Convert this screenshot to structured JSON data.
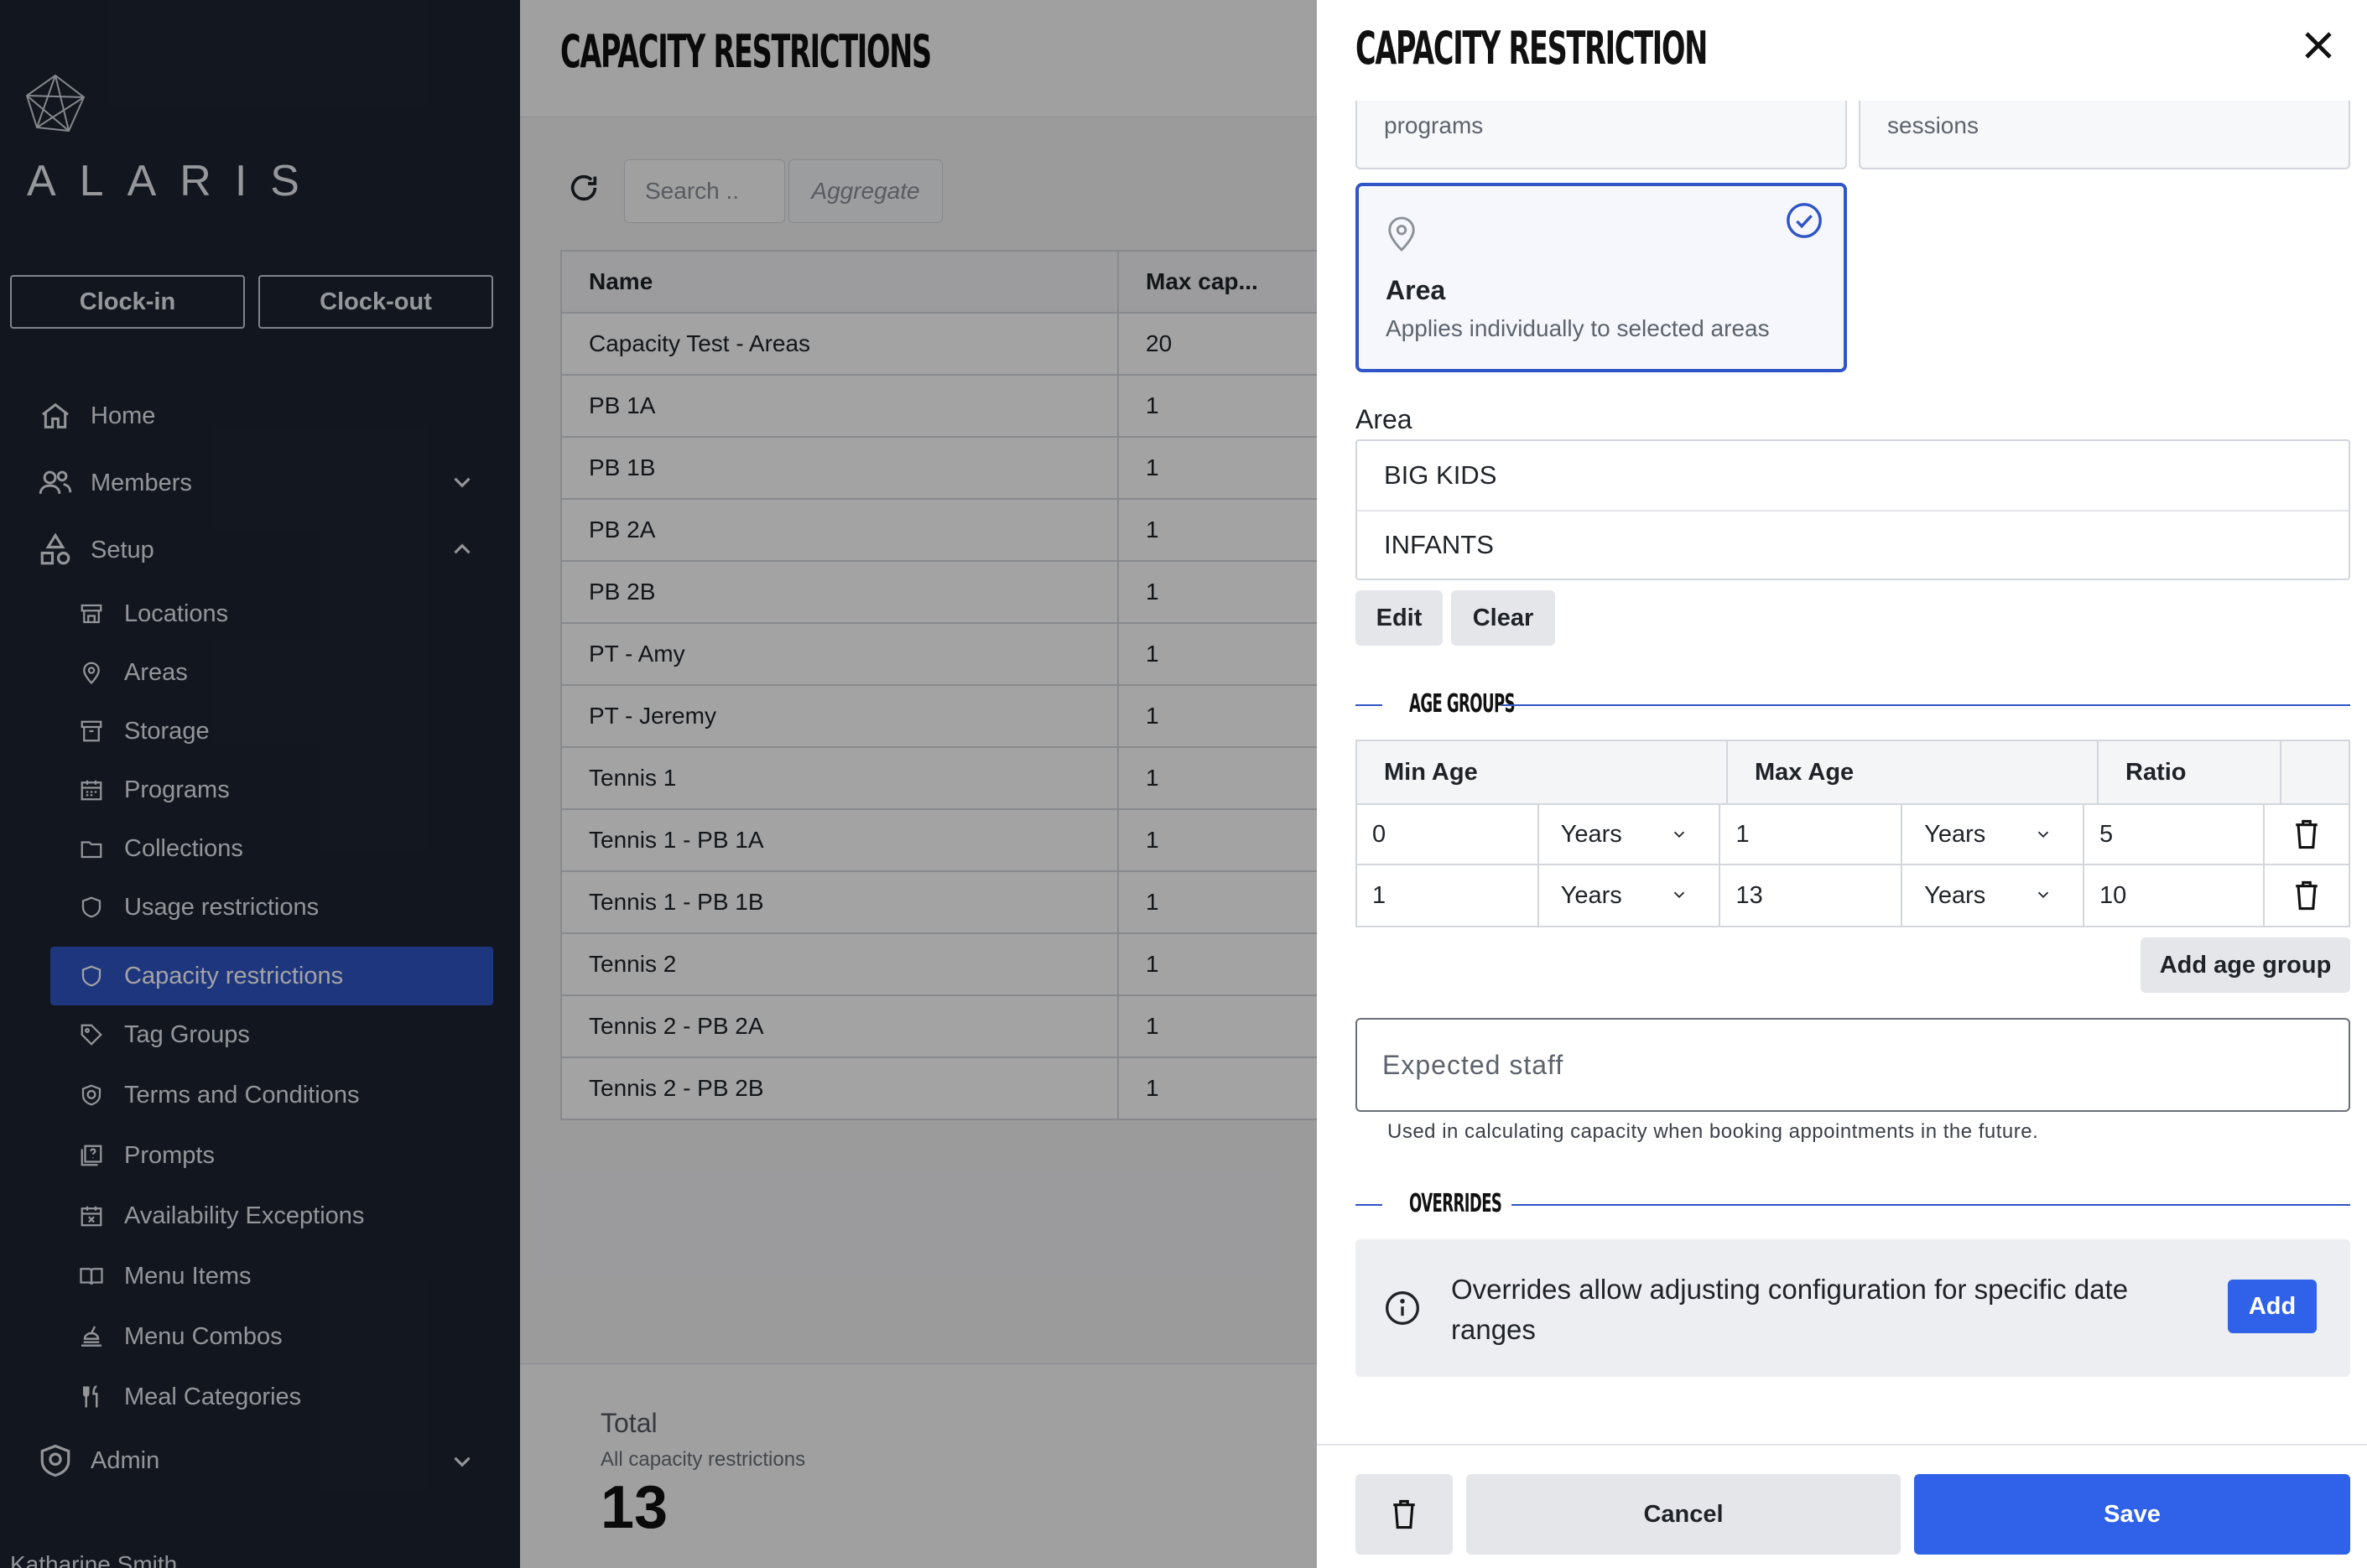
{
  "brand": {
    "logo_text": "ALARIS"
  },
  "sidebar": {
    "clock_in": "Clock-in",
    "clock_out": "Clock-out",
    "home": "Home",
    "members": "Members",
    "setup": "Setup",
    "setup_items": [
      {
        "label": "Locations",
        "icon": "store-icon"
      },
      {
        "label": "Areas",
        "icon": "map-pin-icon"
      },
      {
        "label": "Storage",
        "icon": "archive-icon"
      },
      {
        "label": "Programs",
        "icon": "calendar-icon"
      },
      {
        "label": "Collections",
        "icon": "folder-icon"
      },
      {
        "label": "Usage restrictions",
        "icon": "shield-icon"
      },
      {
        "label": "Capacity restrictions",
        "icon": "shield-icon",
        "active": true
      },
      {
        "label": "Tag Groups",
        "icon": "tag-icon"
      },
      {
        "label": "Terms and Conditions",
        "icon": "shield-check-icon"
      },
      {
        "label": "Prompts",
        "icon": "prompt-icon"
      },
      {
        "label": "Availability Exceptions",
        "icon": "calendar-x-icon"
      },
      {
        "label": "Menu Items",
        "icon": "book-icon"
      },
      {
        "label": "Menu Combos",
        "icon": "food-icon"
      },
      {
        "label": "Meal Categories",
        "icon": "cutlery-icon"
      }
    ],
    "admin": "Admin",
    "user_name": "Katharine Smith"
  },
  "main": {
    "title": "CAPACITY RESTRICTIONS",
    "search_placeholder": "Search ..",
    "aggregate_label": "Aggregate",
    "table": {
      "headers": [
        "Name",
        "Max cap..."
      ],
      "rows": [
        [
          "Capacity Test - Areas",
          "20"
        ],
        [
          "PB 1A",
          "1"
        ],
        [
          "PB 1B",
          "1"
        ],
        [
          "PB 2A",
          "1"
        ],
        [
          "PB 2B",
          "1"
        ],
        [
          "PT - Amy",
          "1"
        ],
        [
          "PT - Jeremy",
          "1"
        ],
        [
          "Tennis 1",
          "1"
        ],
        [
          "Tennis 1 - PB 1A",
          "1"
        ],
        [
          "Tennis 1 - PB 1B",
          "1"
        ],
        [
          "Tennis 2",
          "1"
        ],
        [
          "Tennis 2 - PB 2A",
          "1"
        ],
        [
          "Tennis 2 - PB 2B",
          "1"
        ]
      ]
    },
    "total": {
      "label": "Total",
      "sub": "All capacity restrictions",
      "value": "13"
    }
  },
  "drawer": {
    "title": "CAPACITY RESTRICTION",
    "option_programs": "programs",
    "option_sessions": "sessions",
    "area_option": {
      "title": "Area",
      "desc": "Applies individually to selected areas"
    },
    "area_label": "Area",
    "areas": [
      "BIG KIDS",
      "INFANTS"
    ],
    "edit": "Edit",
    "clear": "Clear",
    "age_groups_label": "AGE GROUPS",
    "age_headers": {
      "min": "Min Age",
      "max": "Max Age",
      "ratio": "Ratio"
    },
    "age_rows": [
      {
        "min": "0",
        "min_unit": "Years",
        "max": "1",
        "max_unit": "Years",
        "ratio": "5"
      },
      {
        "min": "1",
        "min_unit": "Years",
        "max": "13",
        "max_unit": "Years",
        "ratio": "10"
      }
    ],
    "add_age_group": "Add age group",
    "expected_staff_placeholder": "Expected staff",
    "expected_staff_hint": "Used in calculating capacity when booking appointments in the future.",
    "overrides_label": "OVERRIDES",
    "overrides_msg": "Overrides allow adjusting configuration for specific date ranges",
    "overrides_add": "Add",
    "cancel": "Cancel",
    "save": "Save"
  },
  "colors": {
    "sidebar_bg": "#1d2431",
    "accent": "#2f55c6",
    "primary_button": "#2f62e8"
  }
}
